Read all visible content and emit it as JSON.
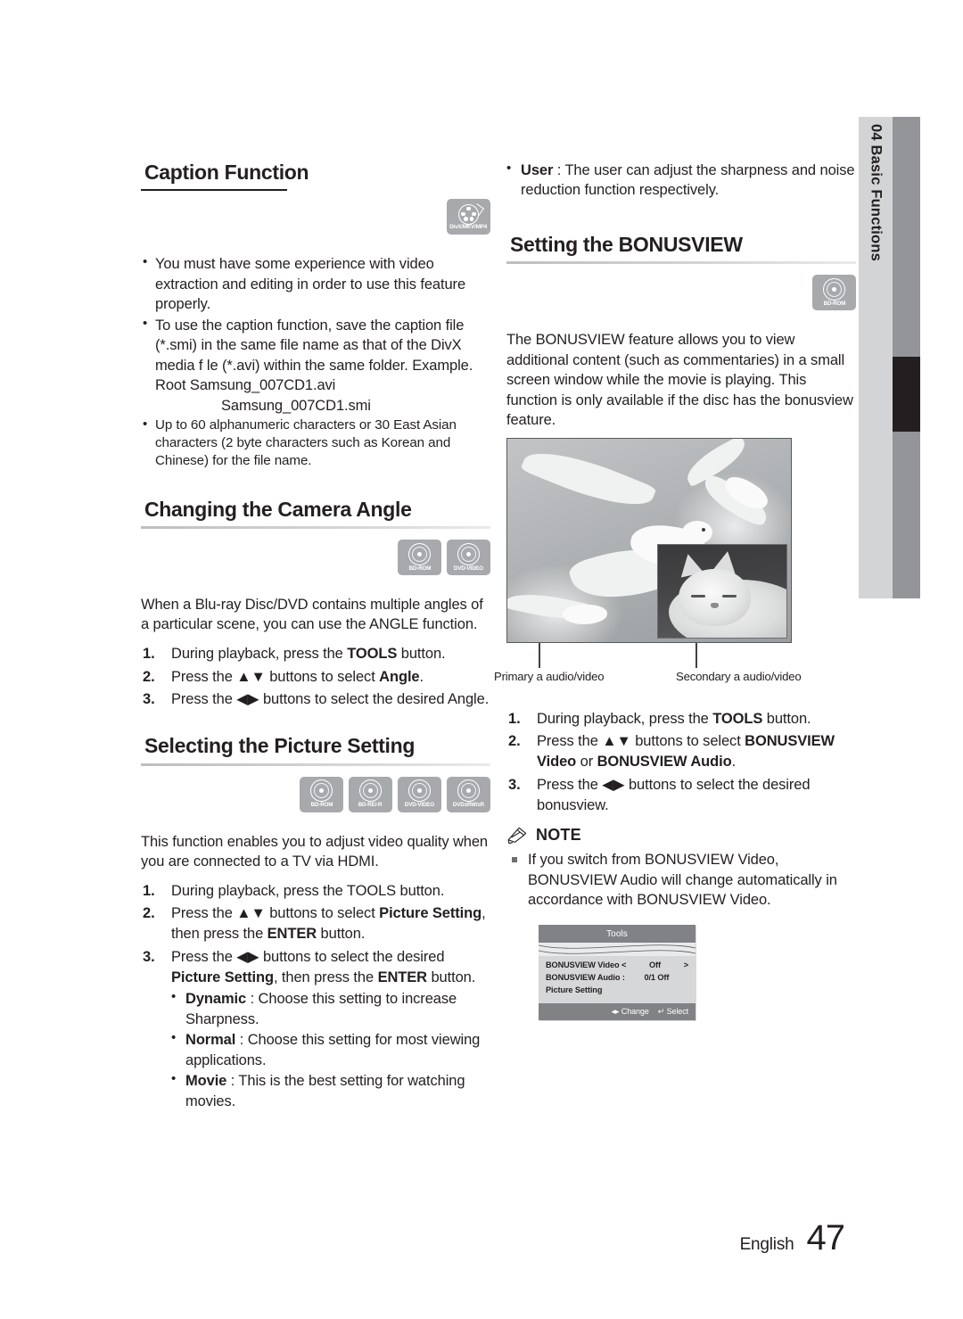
{
  "side_tab": {
    "chapter_number": "04",
    "chapter_title": "Basic Functions",
    "label": "04  Basic Functions"
  },
  "footer": {
    "language": "English",
    "page_number": "47"
  },
  "left_column": {
    "caption_function": {
      "heading": "Caption Function",
      "badges": [
        {
          "id": "divx-mkv-mp4",
          "label": "DivX/MKV/MP4"
        }
      ],
      "bullets": [
        "You must have some experience with video extraction and editing in order to use this feature properly.",
        "To use the caption function, save the caption file (*.smi) in the same file name as that of the DivX media f le (*.avi) within the same folder.",
        "Up to 60 alphanumeric characters or 30 East Asian characters (2 byte characters such as Korean and Chinese) for the file name."
      ],
      "example_line_1": "Example. Root Samsung_007CD1.avi",
      "example_line_2": "Samsung_007CD1.smi"
    },
    "camera_angle": {
      "heading": "Changing the Camera Angle",
      "badges": [
        {
          "id": "bd-rom",
          "label": "BD-ROM"
        },
        {
          "id": "dvd-video",
          "label": "DVD-VIDEO"
        }
      ],
      "intro": "When a Blu-ray Disc/DVD contains multiple angles of a particular scene, you can use the ANGLE function.",
      "steps": [
        {
          "pre": "During playback, press the ",
          "bold": "TOOLS",
          "post": " button."
        },
        {
          "pre": "Press the ▲▼ buttons to select ",
          "bold": "Angle",
          "post": "."
        },
        {
          "pre": "Press the ◀▶ buttons to select the desired Angle.",
          "bold": "",
          "post": ""
        }
      ]
    },
    "picture_setting": {
      "heading": "Selecting the Picture Setting",
      "badges": [
        {
          "id": "bd-rom",
          "label": "BD-ROM"
        },
        {
          "id": "bd-re-r",
          "label": "BD-RE/-R"
        },
        {
          "id": "dvd-video",
          "label": "DVD-VIDEO"
        },
        {
          "id": "dvd-rw-r",
          "label": "DVD±RW/±R"
        }
      ],
      "intro": "This function enables you to adjust video quality when you are connected to a TV via HDMI.",
      "step1": "During playback, press the TOOLS button.",
      "step2_a": "Press the ▲▼ buttons to select ",
      "step2_b": "Picture Setting",
      "step2_c": ", then press the ",
      "step2_d": "ENTER",
      "step2_e": " button.",
      "step3_a": "Press the ◀▶ buttons to select the desired ",
      "step3_b": "Picture Setting",
      "step3_c": ", then press the ",
      "step3_d": "ENTER",
      "step3_e": " button.",
      "options": [
        {
          "name": "Dynamic",
          "text": " : Choose this setting to increase Sharpness."
        },
        {
          "name": "Normal",
          "text": " : Choose this setting for most viewing applications."
        },
        {
          "name": "Movie",
          "text": " : This is the best setting for watching movies."
        }
      ]
    }
  },
  "right_column": {
    "user_option": {
      "name": "User",
      "text": " : The user can adjust the sharpness and noise reduction function respectively."
    },
    "bonusview": {
      "heading": "Setting the BONUSVIEW",
      "badges": [
        {
          "id": "bd-rom",
          "label": "BD-ROM"
        }
      ],
      "intro": "The BONUSVIEW feature allows you to view additional content (such as commentaries) in a small screen window while the movie is playing. This function is only available if the disc has the bonusview feature.",
      "figure": {
        "primary_caption": "Primary a audio/video",
        "secondary_caption": "Secondary a audio/video"
      },
      "step1_a": "During playback, press the ",
      "step1_b": "TOOLS",
      "step1_c": " button.",
      "step2_a": "Press the ▲▼ buttons to select ",
      "step2_b": "BONUSVIEW Video",
      "step2_c": " or ",
      "step2_d": "BONUSVIEW Audio",
      "step2_e": ".",
      "step3": "Press the ◀▶ buttons to select the desired bonusview."
    },
    "note": {
      "label": "NOTE",
      "items": [
        "If you switch from BONUSVIEW Video, BONUSVIEW Audio will change automatically in accordance with BONUSVIEW Video."
      ]
    },
    "tools_osd": {
      "title": "Tools",
      "rows": [
        {
          "label": "BONUSVIEW Video <",
          "value": "Off",
          "right_arrow": ">"
        },
        {
          "label": "BONUSVIEW Audio :",
          "value": "0/1 Off",
          "right_arrow": ""
        },
        {
          "label": "Picture Setting",
          "value": "",
          "right_arrow": ""
        }
      ],
      "footer_change": "◂▸ Change",
      "footer_select": "↵ Select"
    }
  },
  "colors": {
    "badge_gray": "#a7a9ac",
    "side_tab_gray": "#d3d4d6",
    "side_bar_gray": "#939598",
    "side_bar_active": "#231f20",
    "text": "#231f20",
    "osd_header": "#808285",
    "osd_body": "#d6d7d9"
  }
}
